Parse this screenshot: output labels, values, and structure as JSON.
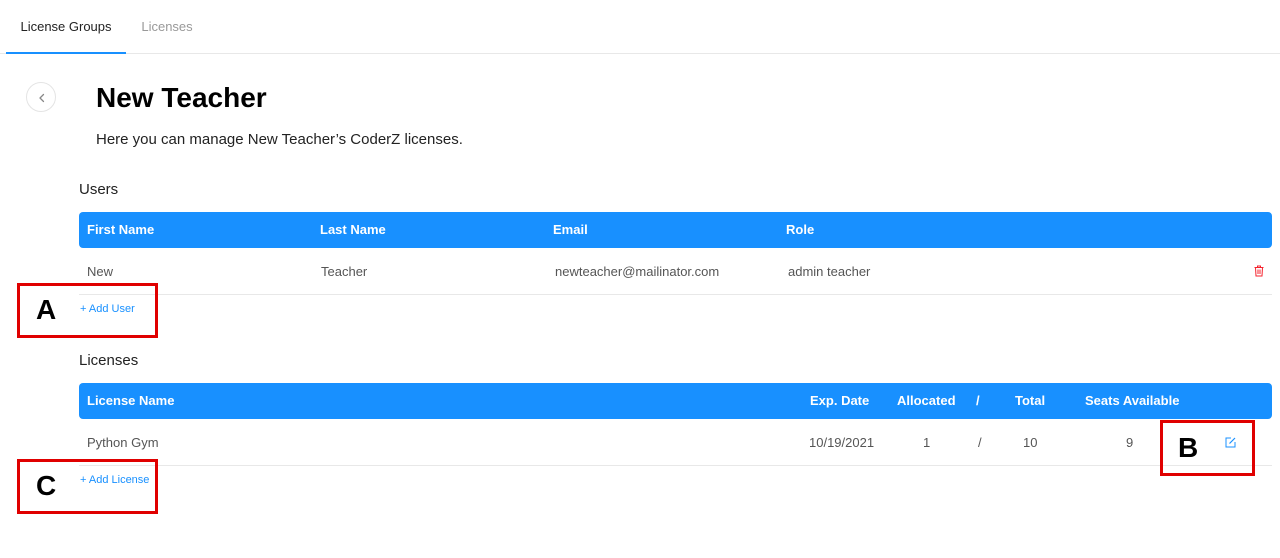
{
  "tabs": [
    {
      "label": "License Groups"
    },
    {
      "label": "Licenses"
    }
  ],
  "page": {
    "title": "New Teacher",
    "description": "Here you can manage New Teacher’s CoderZ licenses."
  },
  "users": {
    "section_label": "Users",
    "columns": [
      "First Name",
      "Last Name",
      "Email",
      "Role"
    ],
    "rows": [
      {
        "first_name": "New",
        "last_name": "Teacher",
        "email": "newteacher@mailinator.com",
        "role": "admin teacher"
      }
    ],
    "add_label": "+ Add User"
  },
  "licenses": {
    "section_label": "Licenses",
    "columns": [
      "License Name",
      "Exp. Date",
      "Allocated",
      "/",
      "Total",
      "Seats Available"
    ],
    "rows": [
      {
        "name": "Python Gym",
        "exp_date": "10/19/2021",
        "allocated": "1",
        "slash": "/",
        "total": "10",
        "seats_available": "9"
      }
    ],
    "add_label": "+ Add License"
  },
  "callouts": [
    {
      "letter": "A"
    },
    {
      "letter": "B"
    },
    {
      "letter": "C"
    }
  ],
  "colors": {
    "accent": "#1890ff",
    "danger": "#f5222d",
    "callout": "#e00000"
  },
  "icons": {
    "back": "chevron-left-icon",
    "delete": "trash-icon",
    "edit": "edit-icon"
  }
}
